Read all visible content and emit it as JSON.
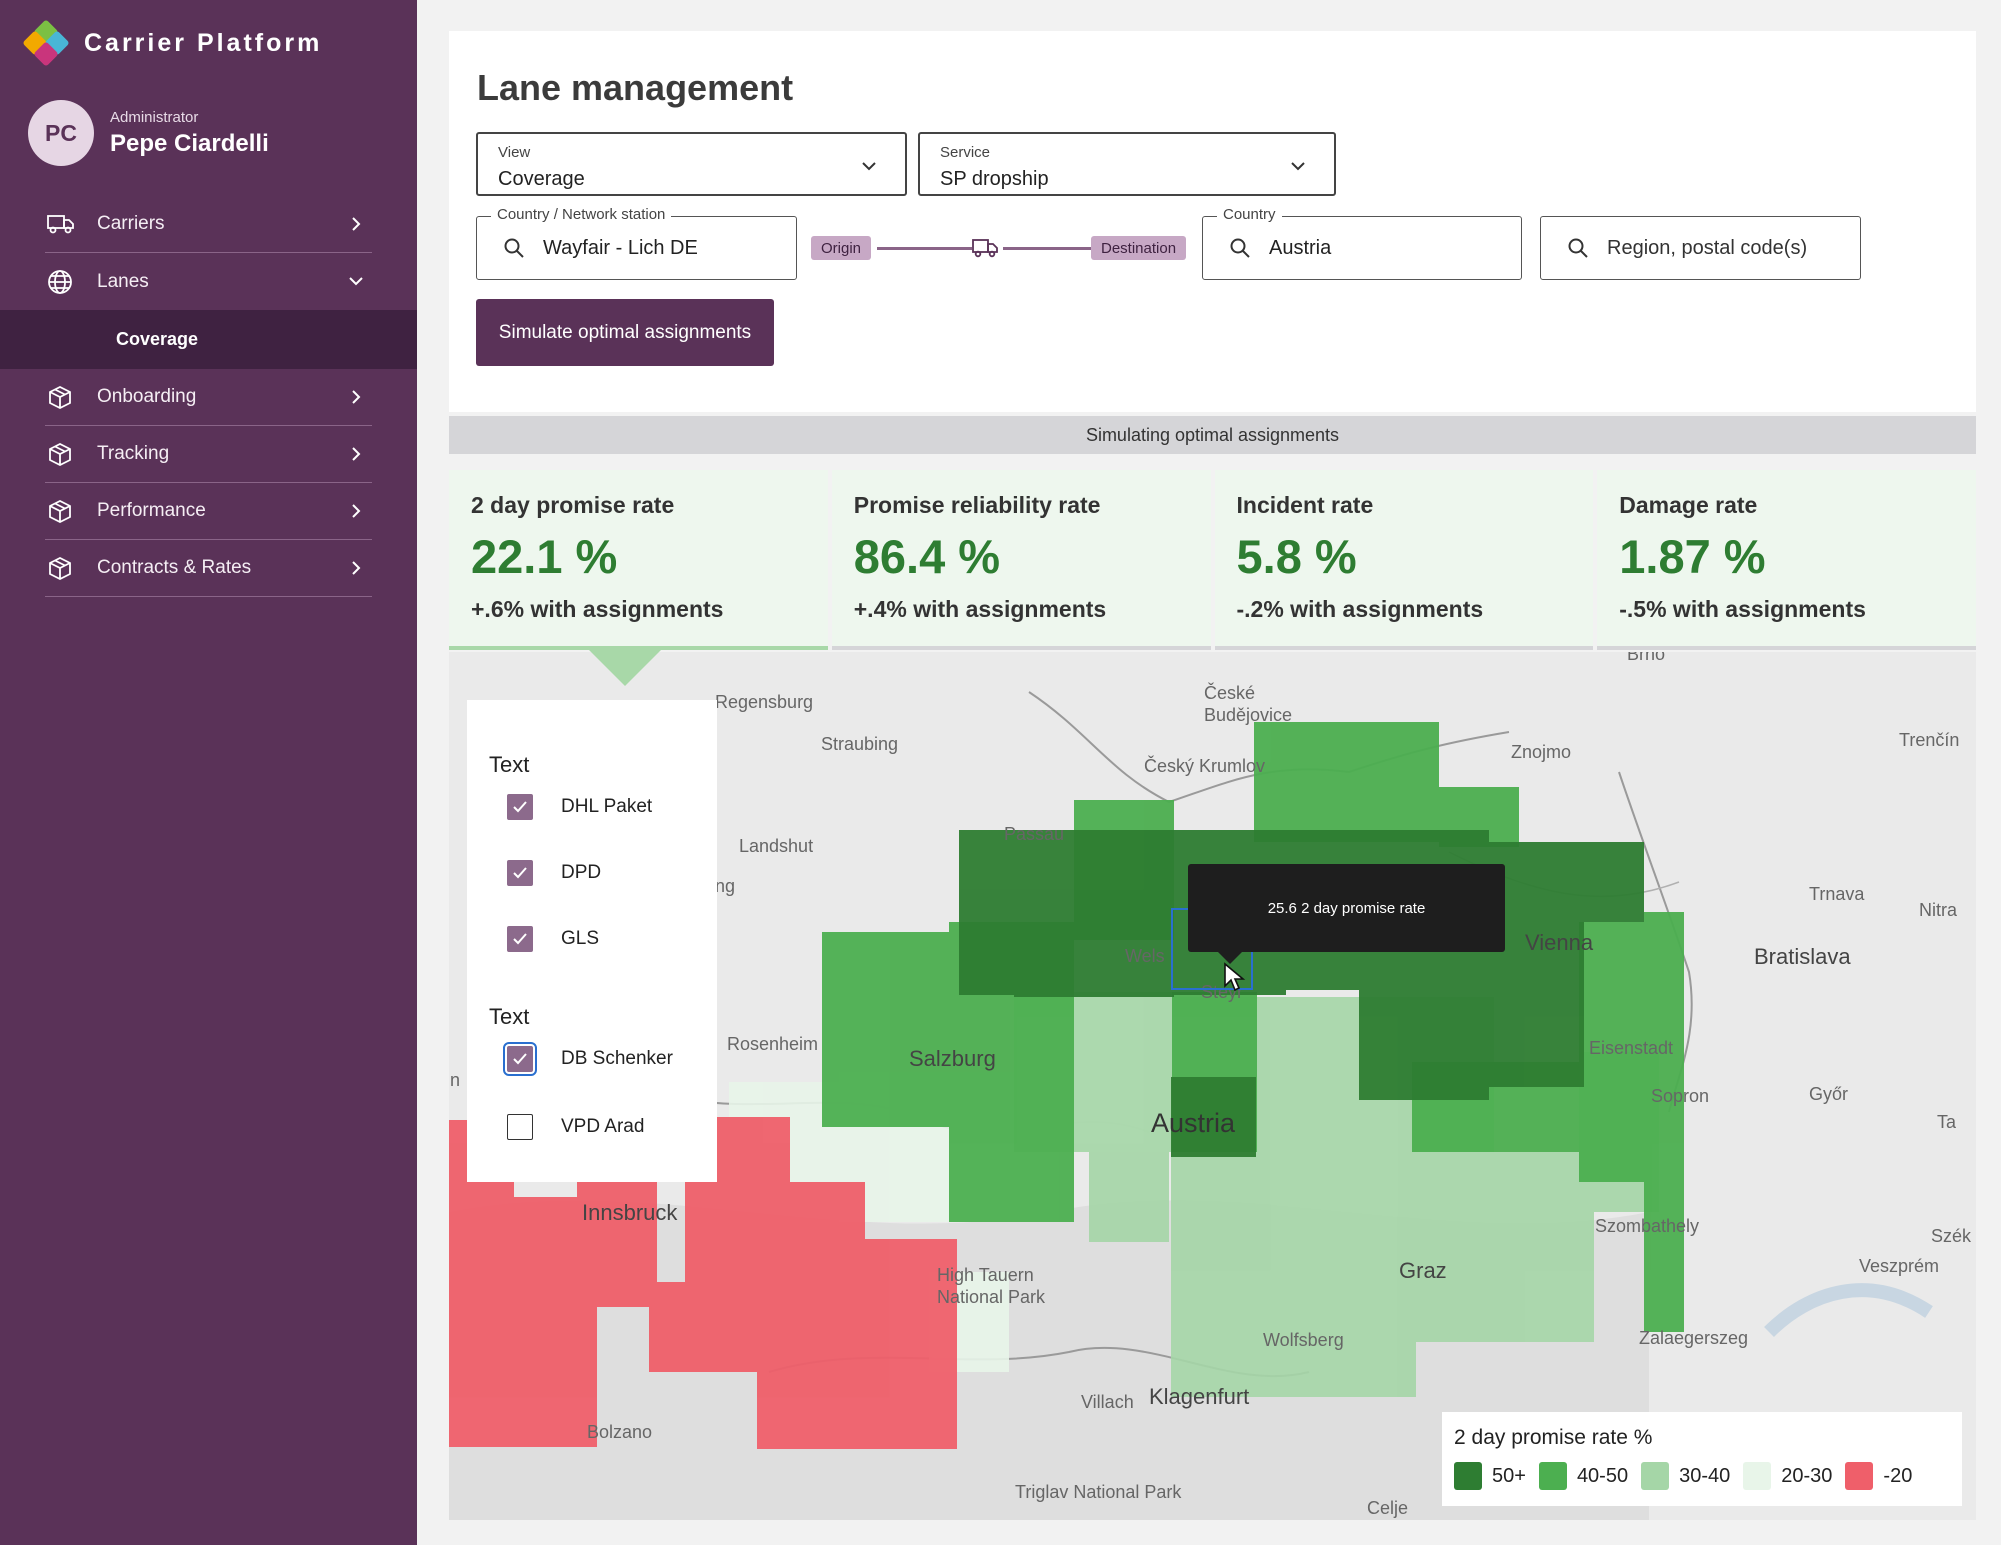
{
  "app": {
    "title": "Carrier Platform"
  },
  "user": {
    "role": "Administrator",
    "name": "Pepe Ciardelli",
    "initials": "PC"
  },
  "nav": {
    "items": [
      {
        "label": "Carriers",
        "icon": "truck-icon"
      },
      {
        "label": "Lanes",
        "icon": "globe-icon",
        "expanded": true
      },
      {
        "label": "Onboarding",
        "icon": "box-icon"
      },
      {
        "label": "Tracking",
        "icon": "box-icon"
      },
      {
        "label": "Performance",
        "icon": "box-icon"
      },
      {
        "label": "Contracts & Rates",
        "icon": "box-icon"
      }
    ],
    "sub_item": "Coverage"
  },
  "page": {
    "title": "Lane management"
  },
  "filters": {
    "view": {
      "label": "View",
      "value": "Coverage"
    },
    "service": {
      "label": "Service",
      "value": "SP dropship"
    },
    "origin_field": {
      "label": "Country / Network station",
      "value": "Wayfair - Lich DE"
    },
    "route": {
      "origin": "Origin",
      "destination": "Destination"
    },
    "country_field": {
      "label": "Country",
      "value": "Austria"
    },
    "region_field": {
      "placeholder": "Region, postal code(s)"
    },
    "simulate_button": "Simulate optimal assignments"
  },
  "banner": "Simulating optimal assignments",
  "kpis": [
    {
      "title": "2 day promise rate",
      "value": "22.1 %",
      "delta": "+.6% with assignments",
      "active": true
    },
    {
      "title": "Promise reliability rate",
      "value": "86.4 %",
      "delta": "+.4% with assignments"
    },
    {
      "title": "Incident rate",
      "value": "5.8 %",
      "delta": "-.2% with assignments"
    },
    {
      "title": "Damage rate",
      "value": "1.87 %",
      "delta": "-.5% with assignments"
    }
  ],
  "carrier_filter": {
    "groups": [
      {
        "title": "Text",
        "items": [
          {
            "label": "DHL Paket",
            "checked": true
          },
          {
            "label": "DPD",
            "checked": true
          },
          {
            "label": "GLS",
            "checked": true
          }
        ]
      },
      {
        "title": "Text",
        "items": [
          {
            "label": "DB Schenker",
            "checked": true
          },
          {
            "label": "VPD Arad",
            "checked": false
          }
        ]
      }
    ]
  },
  "map": {
    "places": [
      "Regensburg",
      "Straubing",
      "České Budějovice",
      "Znojmo",
      "Trenčín",
      "Český Krumlov",
      "Passau",
      "Landshut",
      "Trnava",
      "Nitra",
      "Wels",
      "Vienna",
      "Bratislava",
      "Rosenheim",
      "Salzburg",
      "Steyr",
      "Eisenstadt",
      "Sopron",
      "Győr",
      "Austria",
      "Innsbruck",
      "High Tauern National Park",
      "Graz",
      "Szombathely",
      "Szék",
      "Veszprém",
      "Wolfsberg",
      "Zalaegerszeg",
      "Villach",
      "Klagenfurt",
      "Bolzano",
      "Triglav National Park",
      "Celje",
      "Brno",
      "Ta",
      "ng",
      "n"
    ],
    "tooltip": "25.6 2 day promise rate"
  },
  "legend": {
    "title": "2 day promise rate %",
    "items": [
      {
        "label": "50+",
        "color": "#2e7d32"
      },
      {
        "label": "40-50",
        "color": "#4caf50"
      },
      {
        "label": "30-40",
        "color": "#a5d6a7"
      },
      {
        "label": "20-30",
        "color": "#e8f5e9"
      },
      {
        "label": "-20",
        "color": "#ef5f6a"
      }
    ]
  },
  "colors": {
    "brand": "#5a3258",
    "brand_dark": "#3f2241",
    "kpi_green": "#2e7d32"
  }
}
